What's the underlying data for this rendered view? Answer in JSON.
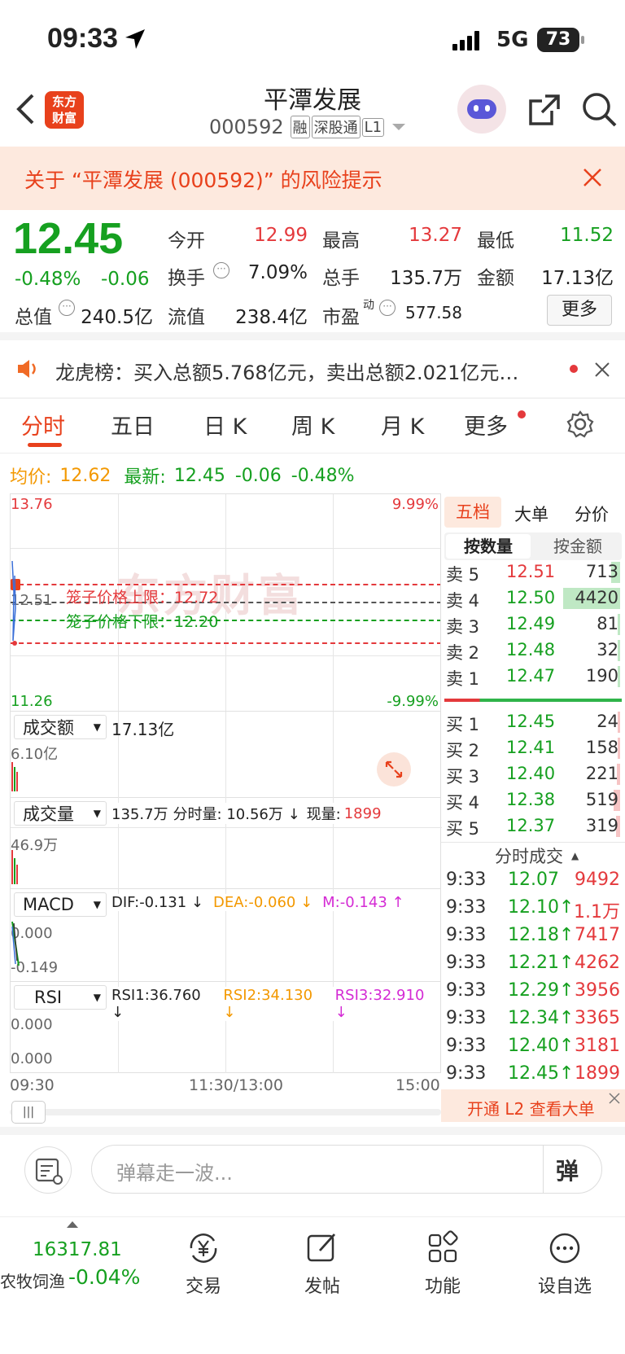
{
  "status": {
    "time": "09:33",
    "network": "5G",
    "battery": "73"
  },
  "header": {
    "title": "平潭发展",
    "code": "000592",
    "tags": [
      "融",
      "深股通",
      "L1"
    ],
    "logo_text_1": "东方",
    "logo_text_2": "财富"
  },
  "risk": {
    "text": "关于 “平潭发展 (000592)” 的风险提示"
  },
  "quote": {
    "price": "12.45",
    "change_pct": "-0.48%",
    "change": "-0.06",
    "open_label": "今开",
    "open": "12.99",
    "high_label": "最高",
    "high": "13.27",
    "low_label": "最低",
    "low": "11.52",
    "turnover_label": "换手",
    "turnover": "7.09%",
    "volume_label": "总手",
    "volume": "135.7万",
    "amount_label": "金额",
    "amount": "17.13亿",
    "mktcap_label": "总值",
    "mktcap": "240.5亿",
    "float_label": "流值",
    "float": "238.4亿",
    "pe_label": "市盈",
    "pe_sup": "动",
    "pe": "577.58",
    "more_button": "更多"
  },
  "notice": {
    "text": "龙虎榜：买入总额5.768亿元，卖出总额2.021亿元…"
  },
  "tabs": [
    "分时",
    "五日",
    "日 K",
    "周 K",
    "月 K",
    "更多"
  ],
  "chart_info": {
    "avg_label": "均价:",
    "avg": "12.62",
    "latest_label": "最新:",
    "latest": "12.45",
    "latest_change": "-0.06",
    "latest_pct": "-0.48%"
  },
  "chart": {
    "y_top": "13.76",
    "y_bottom": "11.26",
    "y_mid": "12.51",
    "pct_top": "9.99%",
    "pct_bottom": "-9.99%",
    "upper_limit": "笼子价格上限：12.72",
    "lower_limit": "笼子价格下限：12.20",
    "watermark": "东方财富",
    "amount_selector": "成交额",
    "amount_value": "17.13亿",
    "amount_axis": "6.10亿",
    "vol_selector": "成交量",
    "vol_value": "135.7万",
    "vol_minute": "分时量: 10.56万 ↓",
    "vol_now_label": "现量:",
    "vol_now": "1899",
    "vol_axis": "46.9万",
    "macd_selector": "MACD",
    "dif": "DIF:-0.131 ↓",
    "dea": "DEA:-0.060 ↓",
    "m": "M:-0.143 ↑",
    "macd_axis_top": "0.000",
    "macd_axis_bottom": "-0.149",
    "rsi_selector": "RSI",
    "rsi1": "RSI1:36.760 ↓",
    "rsi2": "RSI2:34.130 ↓",
    "rsi3": "RSI3:32.910 ↓",
    "rsi_axis_top": "0.000",
    "rsi_axis_bottom": "0.000",
    "x_start": "09:30",
    "x_mid": "11:30/13:00",
    "x_end": "15:00"
  },
  "orderbook": {
    "tabs": [
      "五档",
      "大单",
      "分价"
    ],
    "subtabs": [
      "按数量",
      "按金额"
    ],
    "asks": [
      {
        "label": "卖 5",
        "price": "12.51",
        "qty": "713"
      },
      {
        "label": "卖 4",
        "price": "12.50",
        "qty": "4420"
      },
      {
        "label": "卖 3",
        "price": "12.49",
        "qty": "81"
      },
      {
        "label": "卖 2",
        "price": "12.48",
        "qty": "32"
      },
      {
        "label": "卖 1",
        "price": "12.47",
        "qty": "190"
      }
    ],
    "bids": [
      {
        "label": "买 1",
        "price": "12.45",
        "qty": "24"
      },
      {
        "label": "买 2",
        "price": "12.41",
        "qty": "158"
      },
      {
        "label": "买 3",
        "price": "12.40",
        "qty": "221"
      },
      {
        "label": "买 4",
        "price": "12.38",
        "qty": "519"
      },
      {
        "label": "买 5",
        "price": "12.37",
        "qty": "319"
      }
    ]
  },
  "trades": {
    "title": "分时成交",
    "rows": [
      {
        "time": "9:33",
        "price": "12.07",
        "vol": "9492"
      },
      {
        "time": "9:33",
        "price": "12.10↑",
        "vol": "1.1万"
      },
      {
        "time": "9:33",
        "price": "12.18↑",
        "vol": "7417"
      },
      {
        "time": "9:33",
        "price": "12.21↑",
        "vol": "4262"
      },
      {
        "time": "9:33",
        "price": "12.29↑",
        "vol": "3956"
      },
      {
        "time": "9:33",
        "price": "12.34↑",
        "vol": "3365"
      },
      {
        "time": "9:33",
        "price": "12.40↑",
        "vol": "3181"
      },
      {
        "time": "9:33",
        "price": "12.45↑",
        "vol": "1899"
      }
    ],
    "l2_banner": "开通 L2 查看大单"
  },
  "comment": {
    "placeholder": "弹幕走一波...",
    "danmaku_button": "弹"
  },
  "bottom_nav": {
    "index_value": "16317.81",
    "index_name": "农牧饲渔",
    "index_change": "-0.04%",
    "items": [
      "交易",
      "发帖",
      "功能",
      "设自选"
    ]
  }
}
